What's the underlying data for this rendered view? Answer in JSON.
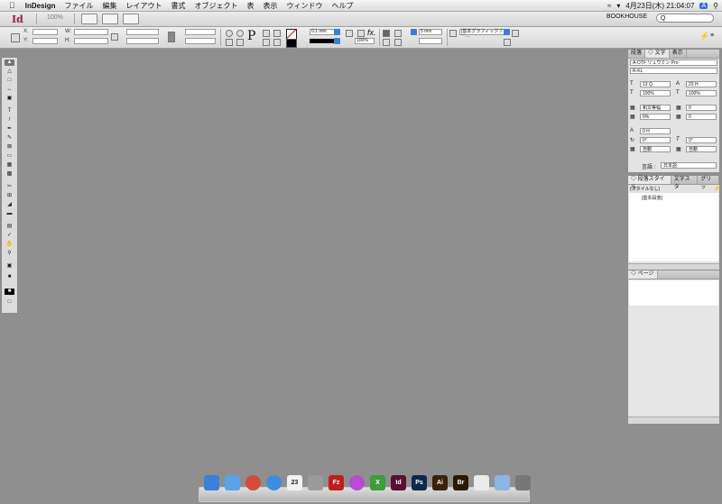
{
  "menubar": {
    "apple": "",
    "app_name": "InDesign",
    "items": [
      "ファイル",
      "編集",
      "レイアウト",
      "書式",
      "オブジェクト",
      "表",
      "表示",
      "ウィンドウ",
      "ヘルプ"
    ],
    "datetime": "4月23日(木)  21:04:07",
    "user": "A"
  },
  "appbar": {
    "logo": "Id",
    "zoom": "100%",
    "workspace": "BOOKHOUSE",
    "search_placeholder": "Q"
  },
  "control": {
    "x_label": "X:",
    "y_label": "Y:",
    "w_label": "W:",
    "h_label": "H:",
    "stroke_weight": "0.1 mm",
    "scale_x": "100%",
    "opacity": "100%",
    "spacing": "5 mm",
    "frame_style": "[基本グラフィックフレー..."
  },
  "panels": {
    "char": {
      "tabs": [
        "段落",
        "◇ 文字",
        "表示"
      ],
      "font": "A-OTF リュウミン Pro",
      "style": "R-KL",
      "size": "13 Q",
      "leading": "23 H",
      "vscale": "100%",
      "hscale": "100%",
      "tsume": "和文等幅",
      "kerning": "0",
      "tracking": "0%",
      "baseline": "0",
      "aki": "0 H",
      "rotate": "0°",
      "skew": "0°",
      "mojikumi_before": "自動",
      "mojikumi_after": "自動",
      "lang_label": "言語 :",
      "lang": "日本語"
    },
    "para_style": {
      "tabs": [
        "◇ 段落スタイル",
        "文字スタ",
        "グリッ"
      ],
      "current": "(スタイルなし)",
      "item": "[基本段落]"
    },
    "pages": {
      "tabs": [
        "◇ ページ"
      ]
    }
  },
  "dock": {
    "apps": [
      {
        "name": "finder",
        "label": "",
        "color": "#3b7fd9"
      },
      {
        "name": "migration",
        "label": "",
        "color": "#5aa3e8"
      },
      {
        "name": "chrome",
        "label": "",
        "color": "#d64a3a"
      },
      {
        "name": "safari",
        "label": "",
        "color": "#3d8ee0"
      },
      {
        "name": "calendar",
        "label": "23",
        "color": "#f2f2f2"
      },
      {
        "name": "script",
        "label": "",
        "color": "#9a9a9a"
      },
      {
        "name": "filezilla",
        "label": "Fz",
        "color": "#bf1e1e"
      },
      {
        "name": "itunes",
        "label": "",
        "color": "#b84bd1"
      },
      {
        "name": "excel-x",
        "label": "X",
        "color": "#3c9e3a"
      },
      {
        "name": "indesign",
        "label": "Id",
        "color": "#5a0f2e"
      },
      {
        "name": "photoshop",
        "label": "Ps",
        "color": "#0c2a4a"
      },
      {
        "name": "illustrator",
        "label": "Ai",
        "color": "#3a2407"
      },
      {
        "name": "bridge",
        "label": "Br",
        "color": "#2a1a05"
      },
      {
        "name": "preview",
        "label": "",
        "color": "#eaeaea"
      },
      {
        "name": "folder",
        "label": "",
        "color": "#8db4e3"
      },
      {
        "name": "trash",
        "label": "",
        "color": "#777"
      }
    ]
  }
}
